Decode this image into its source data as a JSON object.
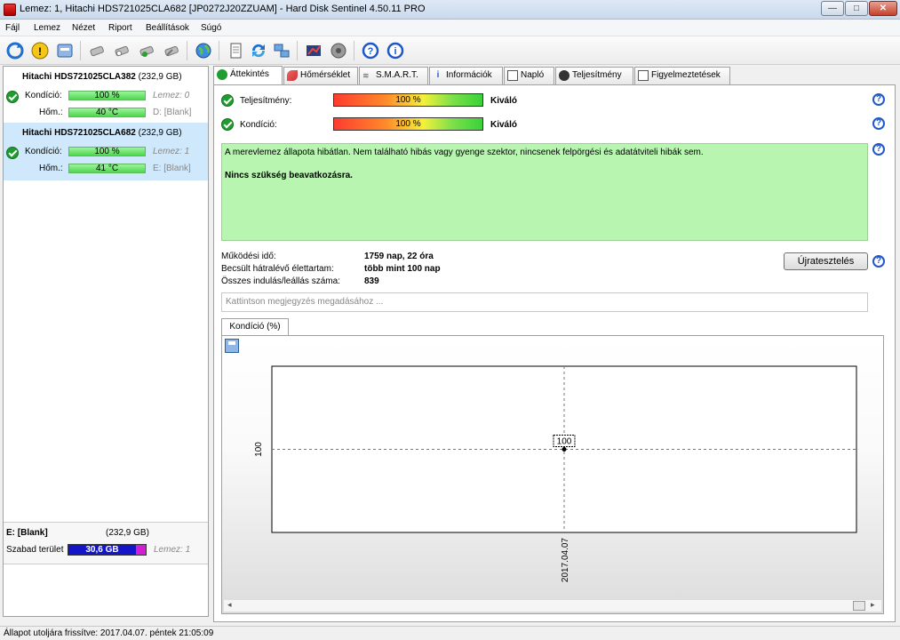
{
  "window": {
    "title": "Lemez: 1, Hitachi HDS721025CLA682 [JP0272J20ZZUAM]  -  Hard Disk Sentinel 4.50.11 PRO",
    "min": "—",
    "max": "□",
    "close": "✕"
  },
  "menu": [
    "Fájl",
    "Lemez",
    "Nézet",
    "Riport",
    "Beállítások",
    "Súgó"
  ],
  "disks": [
    {
      "name": "Hitachi HDS721025CLA382",
      "size": "(232,9 GB)",
      "cond_label": "Kondíció:",
      "cond": "100 %",
      "lemez": "Lemez: 0",
      "temp_label": "Hőm.:",
      "temp": "40 °C",
      "drive": "D: [Blank]"
    },
    {
      "name": "Hitachi HDS721025CLA682",
      "size": "(232,9 GB)",
      "cond_label": "Kondíció:",
      "cond": "100 %",
      "lemez": "Lemez: 1",
      "temp_label": "Hőm.:",
      "temp": "41 °C",
      "drive": "E: [Blank]"
    }
  ],
  "volume": {
    "name": "E: [Blank]",
    "size": "(232,9 GB)",
    "free_label": "Szabad terület",
    "free": "30,6 GB",
    "lemez": "Lemez: 1"
  },
  "tabs": [
    "Áttekintés",
    "Hőmérséklet",
    "S.M.A.R.T.",
    "Információk",
    "Napló",
    "Teljesítmény",
    "Figyelmeztetések"
  ],
  "overview": {
    "perf_label": "Teljesítmény:",
    "perf_value": "100 %",
    "perf_rating": "Kiváló",
    "cond_label": "Kondíció:",
    "cond_value": "100 %",
    "cond_rating": "Kiváló",
    "status_text": "A merevlemez állapota hibátlan. Nem található hibás vagy gyenge szektor, nincsenek felpörgési és adatátviteli hibák sem.",
    "status_action": "Nincs szükség beavatkozásra.",
    "uptime_label": "Működési idő:",
    "uptime": "1759 nap, 22 óra",
    "life_label": "Becsült hátralévő élettartam:",
    "life": "több mint 100 nap",
    "starts_label": "Összes indulás/leállás száma:",
    "starts": "839",
    "retest": "Újratesztelés",
    "note_placeholder": "Kattintson megjegyzés megadásához ...",
    "chart_tab": "Kondíció  (%)"
  },
  "status": "Állapot utoljára frissítve: 2017.04.07. péntek 21:05:09",
  "chart_data": {
    "type": "line",
    "x": [
      "2017.04.07"
    ],
    "series": [
      {
        "values": [
          100
        ]
      }
    ],
    "ylabel": "",
    "xlabel": "",
    "yticks": [
      "100"
    ],
    "data_labels": [
      "100"
    ]
  },
  "colors": {
    "good": "#1f9d2f",
    "status_bg": "#b7f5b1",
    "selected": "#cfe8fb",
    "volume_bar": "#1414c8",
    "volume_free": "#d21ed2"
  }
}
